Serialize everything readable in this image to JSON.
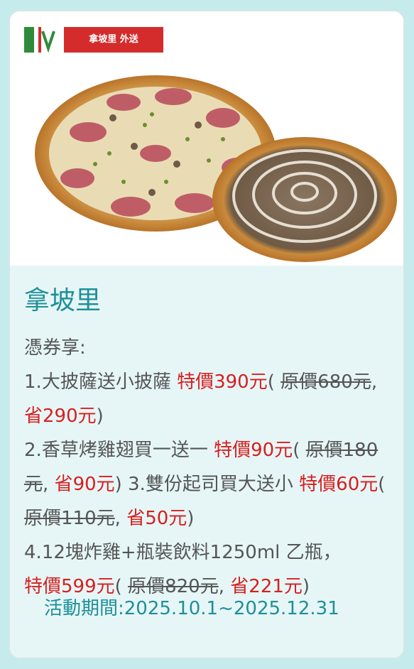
{
  "brand": {
    "logo_text": "拿坡里 外送"
  },
  "card": {
    "title": "拿坡里",
    "intro": "憑券享:",
    "items": [
      {
        "num": "1.",
        "desc": "大披薩送小披薩 ",
        "special_label": "特價",
        "special_price": "390元",
        "open": "( ",
        "orig_label": "原價",
        "orig_price": "680元",
        "sep": ", ",
        "save_label": "省",
        "save_amount": "290元",
        "close": ")"
      },
      {
        "num": "2.",
        "desc": "香草烤雞翅買一送一 ",
        "special_label": "特價",
        "special_price": "90元",
        "open": "( ",
        "orig_label": "原價",
        "orig_price": "180元",
        "sep": ", ",
        "save_label": "省",
        "save_amount": "90元",
        "close": ") "
      },
      {
        "num": "3.",
        "desc": "雙份起司買大送小 ",
        "special_label": "特價",
        "special_price": "60元",
        "open": "( ",
        "orig_label": "原價",
        "orig_price": "110元",
        "sep": ", ",
        "save_label": "省",
        "save_amount": "50元",
        "close": ")"
      },
      {
        "num": "4.",
        "desc": "12塊炸雞+瓶裝飲料1250ml 乙瓶，",
        "special_label": "特價",
        "special_price": "599元",
        "open": "( ",
        "orig_label": "原價",
        "orig_price": "820元",
        "sep": ", ",
        "save_label": "省",
        "save_amount": "221元",
        "close": ")"
      }
    ],
    "period": "活動期間:2025.10.1~2025.12.31"
  },
  "colors": {
    "page_bg": "#c5ebed",
    "content_bg": "#e6f6f7",
    "title": "#1f8f98",
    "accent_red": "#d81e1e",
    "body_text": "#555555"
  }
}
